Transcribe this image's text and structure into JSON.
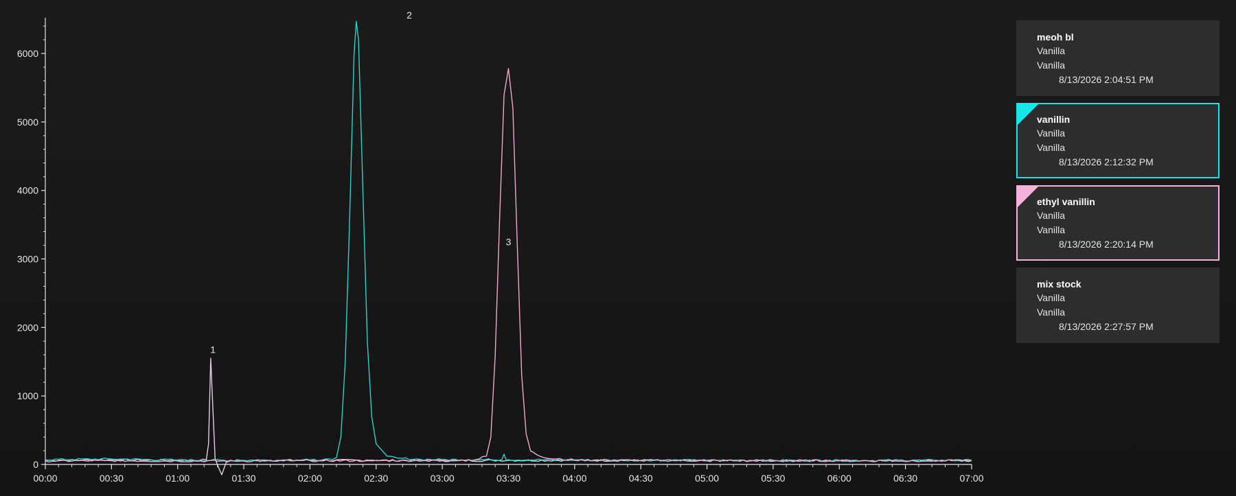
{
  "colors": {
    "series_1": "#e6cdea",
    "series_2": "#2ad4cc",
    "series_3": "#f2a7d2",
    "axis": "#e6e6e6",
    "card_bg": "#2d2d2d",
    "card_selected_1": "#19e6ea",
    "card_selected_2": "#f3b3da"
  },
  "samples": [
    {
      "name": "meoh bl",
      "line1": "Vanilla",
      "line2": "Vanilla",
      "date": "8/13/2026 2:04:51 PM",
      "selected": false,
      "color": ""
    },
    {
      "name": "vanillin",
      "line1": "Vanilla",
      "line2": "Vanilla",
      "date": "8/13/2026 2:12:32 PM",
      "selected": true,
      "color": "#19e6ea"
    },
    {
      "name": "ethyl vanillin",
      "line1": "Vanilla",
      "line2": "Vanilla",
      "date": "8/13/2026 2:20:14 PM",
      "selected": true,
      "color": "#f3b3da"
    },
    {
      "name": "mix stock",
      "line1": "Vanilla",
      "line2": "Vanilla",
      "date": "8/13/2026 2:27:57 PM",
      "selected": false,
      "color": ""
    }
  ],
  "chart_data": {
    "type": "line",
    "title": "",
    "xlabel": "",
    "ylabel": "",
    "xlim": [
      "00:00",
      "07:00"
    ],
    "ylim": [
      0,
      6500
    ],
    "x_ticks": [
      "00:00",
      "00:30",
      "01:00",
      "01:30",
      "02:00",
      "02:30",
      "03:00",
      "03:30",
      "04:00",
      "04:30",
      "05:00",
      "05:30",
      "06:00",
      "06:30",
      "07:00"
    ],
    "y_ticks": [
      "0",
      "1000",
      "2000",
      "3000",
      "4000",
      "5000",
      "6000"
    ],
    "grid": false,
    "legend": "none",
    "series": [
      {
        "color": "#e6cdea",
        "x": [
          "00:00",
          "00:30",
          "01:00",
          "01:10",
          "01:13",
          "01:14",
          "01:15",
          "01:16",
          "01:17",
          "01:18",
          "01:19",
          "01:20",
          "01:22",
          "01:24",
          "01:30",
          "02:00",
          "02:30",
          "03:00",
          "03:30",
          "04:00",
          "05:00",
          "06:00",
          "07:00"
        ],
        "y": [
          60,
          65,
          60,
          60,
          70,
          300,
          1550,
          800,
          80,
          0,
          -80,
          -150,
          30,
          55,
          60,
          60,
          60,
          55,
          60,
          60,
          55,
          55,
          55
        ]
      },
      {
        "color": "#2ad4cc",
        "x": [
          "00:00",
          "00:30",
          "01:00",
          "01:30",
          "02:00",
          "02:10",
          "02:12",
          "02:14",
          "02:16",
          "02:18",
          "02:20",
          "02:21",
          "02:22",
          "02:24",
          "02:26",
          "02:28",
          "02:30",
          "02:35",
          "02:40",
          "02:50",
          "03:00",
          "03:27",
          "03:28",
          "03:29",
          "03:30",
          "04:00",
          "05:00",
          "06:00",
          "07:00"
        ],
        "y": [
          70,
          80,
          65,
          60,
          65,
          70,
          100,
          400,
          1500,
          3600,
          6000,
          6470,
          6200,
          4000,
          1800,
          700,
          300,
          120,
          90,
          75,
          70,
          70,
          150,
          60,
          70,
          65,
          60,
          60,
          60
        ]
      },
      {
        "color": "#f2a7d2",
        "x": [
          "00:00",
          "00:30",
          "01:00",
          "01:30",
          "02:00",
          "02:30",
          "03:00",
          "03:15",
          "03:20",
          "03:22",
          "03:24",
          "03:26",
          "03:28",
          "03:30",
          "03:32",
          "03:34",
          "03:36",
          "03:38",
          "03:40",
          "03:43",
          "03:46",
          "03:50",
          "04:00",
          "05:00",
          "06:00",
          "07:00"
        ],
        "y": [
          50,
          55,
          50,
          50,
          55,
          55,
          60,
          70,
          120,
          400,
          1600,
          3600,
          5400,
          5780,
          5200,
          3200,
          1300,
          450,
          200,
          140,
          100,
          80,
          65,
          55,
          55,
          55
        ]
      }
    ],
    "annotations": [
      {
        "text": "1",
        "x": "01:16",
        "y": 1630
      },
      {
        "text": "2",
        "x": "02:45",
        "y": 6510
      },
      {
        "text": "3",
        "x": "03:30",
        "y": 3200
      }
    ]
  }
}
